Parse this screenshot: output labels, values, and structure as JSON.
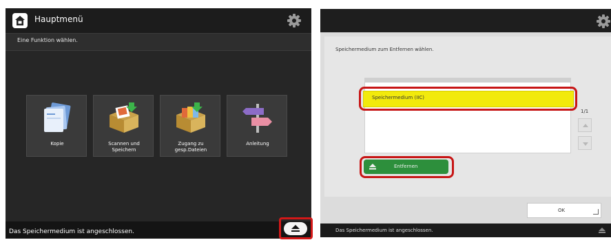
{
  "left": {
    "title": "Hauptmenü",
    "subtitle": "Eine Funktion wählen.",
    "tiles": [
      {
        "line1": "Kopie",
        "line2": "",
        "icon": "copy-icon"
      },
      {
        "line1": "Scannen und",
        "line2": "Speichern",
        "icon": "scan-store-box-icon"
      },
      {
        "line1": "Zugang zu",
        "line2": "gesp.Dateien",
        "icon": "stored-files-box-icon"
      },
      {
        "line1": "Anleitung",
        "line2": "",
        "icon": "signpost-icon"
      }
    ],
    "status": "Das Speichermedium ist angeschlossen.",
    "eject_icon": "eject-icon"
  },
  "right": {
    "instruction": "Speichermedium zum Entfernen wählen.",
    "list_item": "Speichermedium (IIC)",
    "page": "1/1",
    "remove_label": "Entfernen",
    "ok_label": "OK",
    "status": "Das Speichermedium ist angeschlossen."
  },
  "colors": {
    "highlight": "#d31818",
    "selected": "#f2ea0c",
    "remove_button": "#2d8f3c"
  }
}
